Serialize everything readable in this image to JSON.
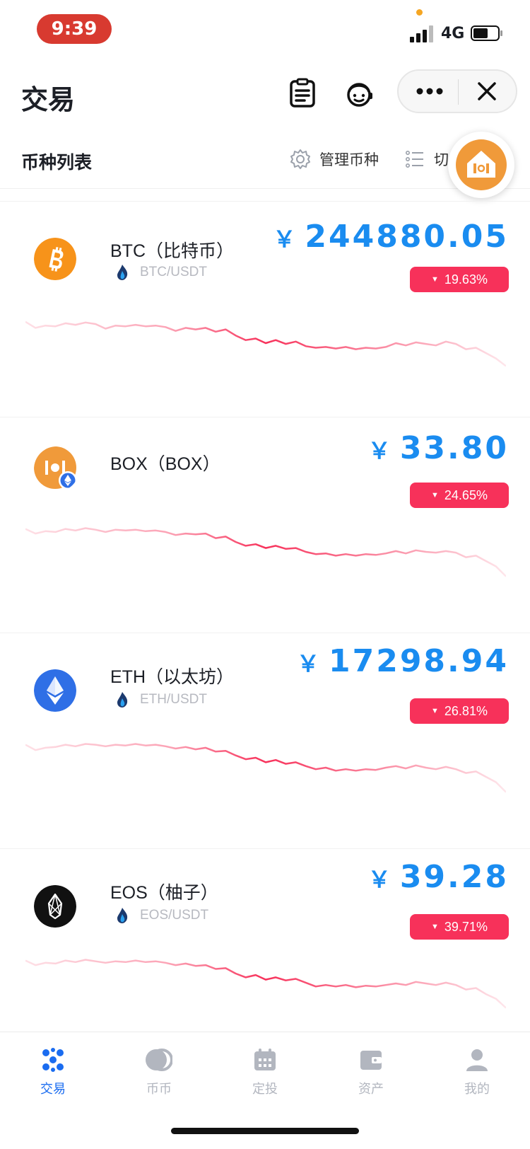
{
  "status_bar": {
    "time": "9:39",
    "network": "4G"
  },
  "header": {
    "title": "交易"
  },
  "section": {
    "title": "币种列表",
    "manage_label": "管理币种",
    "switch_label": "切"
  },
  "colors": {
    "price_blue": "#1a8cf0",
    "down_red": "#f7315a",
    "nav_active": "#1a6cf0",
    "nav_inactive": "#b2b6bf"
  },
  "coins": [
    {
      "name": "BTC（比特币）",
      "pair": "BTC/USDT",
      "currency": "￥",
      "price": "244880.05",
      "change": "19.63%",
      "direction": "down",
      "icon": "bitcoin-icon",
      "trend": [
        0.78,
        0.7,
        0.73,
        0.72,
        0.76,
        0.74,
        0.77,
        0.75,
        0.69,
        0.73,
        0.72,
        0.74,
        0.72,
        0.73,
        0.71,
        0.66,
        0.7,
        0.68,
        0.7,
        0.65,
        0.68,
        0.6,
        0.54,
        0.56,
        0.5,
        0.54,
        0.49,
        0.52,
        0.46,
        0.44,
        0.45,
        0.43,
        0.45,
        0.42,
        0.44,
        0.43,
        0.45,
        0.5,
        0.47,
        0.51,
        0.49,
        0.47,
        0.52,
        0.49,
        0.42,
        0.44,
        0.37,
        0.3,
        0.2
      ]
    },
    {
      "name": "BOX（BOX）",
      "pair": "",
      "currency": "￥",
      "price": "33.80",
      "change": "24.65%",
      "direction": "down",
      "icon": "box-token-icon",
      "trend": [
        0.8,
        0.74,
        0.77,
        0.76,
        0.8,
        0.78,
        0.81,
        0.79,
        0.76,
        0.79,
        0.78,
        0.79,
        0.77,
        0.78,
        0.76,
        0.72,
        0.74,
        0.73,
        0.74,
        0.68,
        0.7,
        0.63,
        0.58,
        0.6,
        0.55,
        0.58,
        0.54,
        0.55,
        0.5,
        0.47,
        0.48,
        0.45,
        0.47,
        0.45,
        0.47,
        0.46,
        0.48,
        0.51,
        0.48,
        0.52,
        0.5,
        0.49,
        0.51,
        0.49,
        0.43,
        0.45,
        0.38,
        0.31,
        0.18
      ]
    },
    {
      "name": "ETH（以太坊）",
      "pair": "ETH/USDT",
      "currency": "￥",
      "price": "17298.94",
      "change": "26.81%",
      "direction": "down",
      "icon": "ethereum-icon",
      "trend": [
        0.8,
        0.73,
        0.76,
        0.77,
        0.8,
        0.78,
        0.81,
        0.8,
        0.78,
        0.8,
        0.79,
        0.81,
        0.79,
        0.8,
        0.78,
        0.75,
        0.77,
        0.74,
        0.76,
        0.71,
        0.72,
        0.66,
        0.61,
        0.63,
        0.57,
        0.6,
        0.55,
        0.57,
        0.52,
        0.48,
        0.5,
        0.46,
        0.48,
        0.46,
        0.48,
        0.47,
        0.5,
        0.52,
        0.49,
        0.53,
        0.5,
        0.48,
        0.51,
        0.48,
        0.43,
        0.45,
        0.38,
        0.31,
        0.18
      ]
    },
    {
      "name": "EOS（柚子）",
      "pair": "EOS/USDT",
      "currency": "￥",
      "price": "39.28",
      "change": "39.71%",
      "direction": "down",
      "icon": "eos-icon",
      "trend": [
        0.8,
        0.74,
        0.77,
        0.76,
        0.8,
        0.78,
        0.81,
        0.79,
        0.77,
        0.79,
        0.78,
        0.8,
        0.78,
        0.79,
        0.77,
        0.74,
        0.76,
        0.73,
        0.74,
        0.69,
        0.7,
        0.63,
        0.58,
        0.61,
        0.55,
        0.58,
        0.54,
        0.56,
        0.51,
        0.46,
        0.48,
        0.46,
        0.48,
        0.45,
        0.47,
        0.46,
        0.48,
        0.5,
        0.48,
        0.52,
        0.5,
        0.48,
        0.51,
        0.48,
        0.42,
        0.44,
        0.36,
        0.3,
        0.18
      ]
    }
  ],
  "bottom_nav": [
    {
      "label": "交易",
      "icon": "trade-icon",
      "active": true
    },
    {
      "label": "币币",
      "icon": "coin-coin-icon",
      "active": false
    },
    {
      "label": "定投",
      "icon": "calendar-icon",
      "active": false
    },
    {
      "label": "资产",
      "icon": "wallet-icon",
      "active": false
    },
    {
      "label": "我的",
      "icon": "user-icon",
      "active": false
    }
  ]
}
